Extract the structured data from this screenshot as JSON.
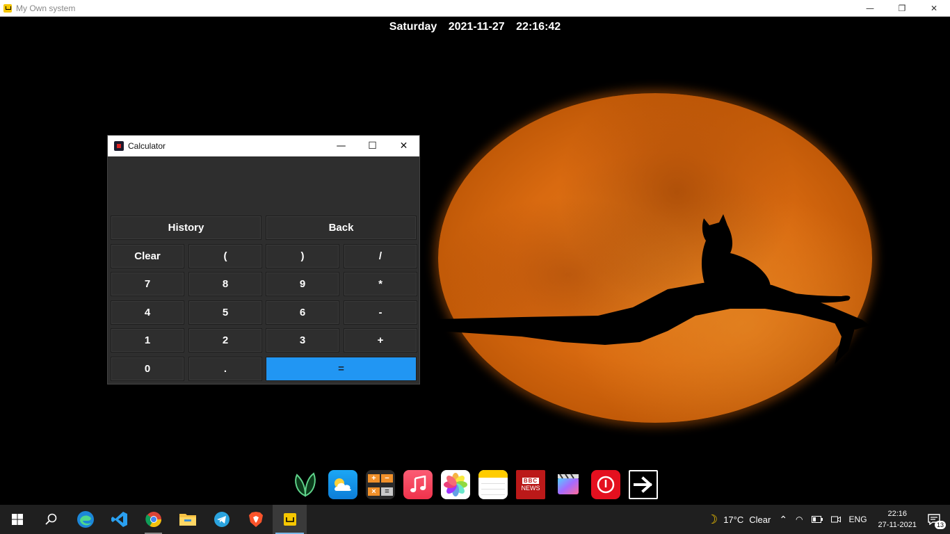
{
  "outer_window": {
    "title": "My Own system",
    "minimize": "—",
    "restore": "❐",
    "close": "✕"
  },
  "clock": {
    "day": "Saturday",
    "date": "2021-11-27",
    "time": "22:16:42"
  },
  "calculator": {
    "title": "Calculator",
    "minimize": "—",
    "maximize": "☐",
    "close": "✕",
    "display": "",
    "keys": {
      "history": "History",
      "back": "Back",
      "clear": "Clear",
      "lparen": "(",
      "rparen": ")",
      "divide": "/",
      "seven": "7",
      "eight": "8",
      "nine": "9",
      "multiply": "*",
      "four": "4",
      "five": "5",
      "six": "6",
      "minus": "-",
      "one": "1",
      "two": "2",
      "three": "3",
      "plus": "+",
      "zero": "0",
      "dot": ".",
      "equals": "="
    },
    "equals_color": "#2196f3"
  },
  "dock": {
    "news_label_1": "BBC",
    "news_label_2": "NEWS",
    "items": [
      "leaf-app-icon",
      "weather-app-icon",
      "calculator-app-icon",
      "music-app-icon",
      "photos-app-icon",
      "notes-app-icon",
      "bbc-news-app-icon",
      "video-editor-app-icon",
      "power-app-icon",
      "next-arrow-app-icon"
    ]
  },
  "taskbar": {
    "weather_temp": "17°C",
    "weather_text": "Clear",
    "language": "ENG",
    "time": "22:16",
    "date": "27-11-2021",
    "notification_count": "13"
  }
}
